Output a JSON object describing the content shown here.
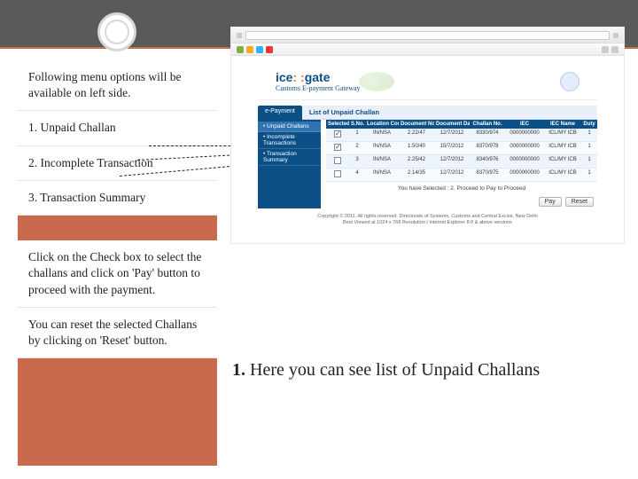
{
  "left": {
    "intro": "Following menu options will be available on left side.",
    "opt1": "1. Unpaid Challan",
    "opt2": "2. Incomplete Transaction",
    "opt3": "3. Transaction Summary",
    "para1": "Click on the Check box to select the challans and click on 'Pay' button to proceed with the payment.",
    "para2": "You can reset the selected Challans by clicking on 'Reset' button."
  },
  "main_note_num": "1.",
  "main_note_text": " Here you can see list of Unpaid Challans",
  "app": {
    "brand_ice": "ice",
    "brand_sep": ": :",
    "brand_gate": "gate",
    "tagline": "Customs E-payment Gateway",
    "tab_epay": "e-Payment",
    "list_title": "List of Unpaid Challan",
    "menu": {
      "m1": "• Unpaid Challans",
      "m2": "• Incomplete Transactions",
      "m3": "• Transaction Summary"
    },
    "headers": {
      "sel": "Selected : 2",
      "sno": "S.No.",
      "loc": "Location Code",
      "doc": "Document No.",
      "dat": "Document Date",
      "chl": "Challan No.",
      "iec": "IEC",
      "ien": "IEC Name",
      "dut": "Duty"
    },
    "rows": [
      {
        "ck": true,
        "sno": "1",
        "loc": "IN/NSA",
        "doc": "2.22/47",
        "dat": "12/7/2012",
        "chl": "8330/974",
        "iec": "0000000000",
        "ien": "ICL/MY ICB",
        "dut": "1"
      },
      {
        "ck": true,
        "sno": "2",
        "loc": "IN/NSA",
        "doc": "1.50/40",
        "dat": "15/7/2012",
        "chl": "8370/978",
        "iec": "0000000000",
        "ien": "ICL/MY ICB",
        "dut": "1"
      },
      {
        "ck": false,
        "sno": "3",
        "loc": "IN/NSA",
        "doc": "2.25/42",
        "dat": "12/7/2012",
        "chl": "8340/976",
        "iec": "0000000000",
        "ien": "ICL/MY ICB",
        "dut": "1"
      },
      {
        "ck": false,
        "sno": "4",
        "loc": "IN/NSA",
        "doc": "2.14/35",
        "dat": "12/7/2012",
        "chl": "8370/975",
        "iec": "0000000000",
        "ien": "ICL/MY ICB",
        "dut": "1"
      }
    ],
    "sel_note": "You have Selected : 2. Proceed to Pay to Proceed",
    "btn_pay": "Pay",
    "btn_reset": "Reset",
    "copy1": "Copyright © 2011. All rights reserved. Directorate of Systems, Customs and Central Excise, New Delhi",
    "copy2": "Best Viewed at 1024 x 768 Resolution | Internet Explorer 8.0 & above versions"
  }
}
